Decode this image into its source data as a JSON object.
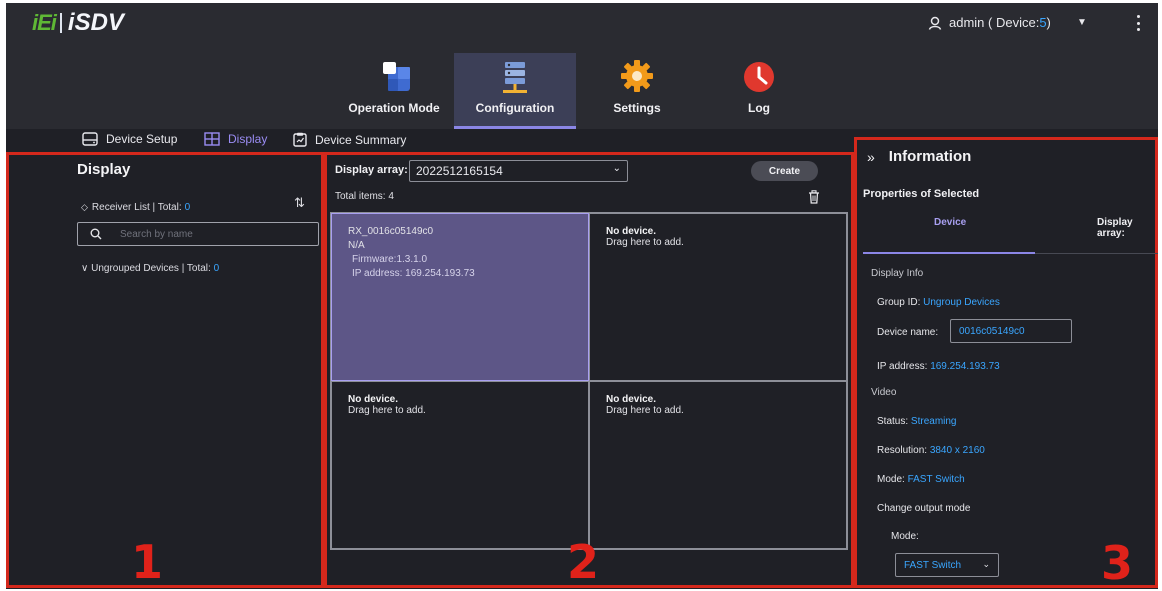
{
  "header": {
    "logo_left": "iEi",
    "logo_right": "iSDV",
    "user_label": "admin ( Device: ",
    "user_count": "5",
    "user_close": " )",
    "nav": [
      {
        "label": "Operation Mode",
        "icon": "operation-mode-icon"
      },
      {
        "label": "Configuration",
        "icon": "configuration-icon",
        "active": true
      },
      {
        "label": "Settings",
        "icon": "settings-gear-icon"
      },
      {
        "label": "Log",
        "icon": "log-clock-icon"
      }
    ]
  },
  "tabs": {
    "device_setup": "Device Setup",
    "display": "Display",
    "device_summary": "Device Summary"
  },
  "panel1": {
    "title": "Display",
    "receiver_label": "Receiver List | Total: ",
    "receiver_total": "0",
    "search_placeholder": "Search by name",
    "group_label": "Ungrouped Devices | Total: ",
    "group_total": "0",
    "number": "1"
  },
  "panel2": {
    "array_label": "Display array:",
    "array_value": "2022512165154",
    "create_label": "Create",
    "total_items": "Total items: 4",
    "cells": [
      {
        "line1": "RX_0016c05149c0",
        "line2": "N/A",
        "line3": "Firmware:1.3.1.0",
        "line4": "IP address: 169.254.193.73"
      },
      {
        "line1": "No device.",
        "line2": "Drag here to add."
      },
      {
        "line1": "No device.",
        "line2": "Drag here to add."
      },
      {
        "line1": "No device.",
        "line2": "Drag here to add."
      }
    ],
    "number": "2"
  },
  "panel3": {
    "title": "Information",
    "properties": "Properties of Selected",
    "tab_device": "Device",
    "tab_array": "Display array:",
    "display_info": "Display Info",
    "group_id_label": "Group ID:",
    "group_id_value": "Ungroup Devices",
    "device_name_label": "Device name:",
    "device_name_value": "0016c05149c0",
    "ip_label": "IP address:",
    "ip_value": "169.254.193.73",
    "video": "Video",
    "status_label": "Status:",
    "status_value": "Streaming",
    "resolution_label": "Resolution:",
    "resolution_value": "3840 x 2160",
    "mode_label": "Mode:",
    "mode_value": "FAST Switch",
    "change_output": "Change output mode",
    "mode2_label": "Mode:",
    "mode_select_value": "FAST Switch",
    "number": "3"
  },
  "colors": {
    "accent": "#8b86e6",
    "link_blue": "#3aa6ff",
    "highlight_red": "#d4281c",
    "logo_green": "#5fb835"
  }
}
